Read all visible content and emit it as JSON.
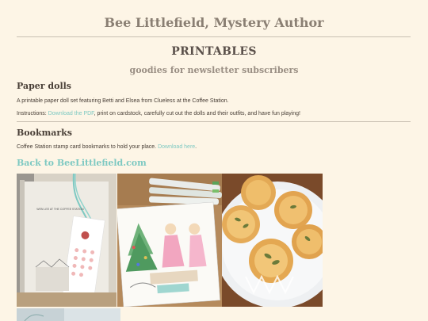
{
  "header": {
    "site_title": "Bee Littlefield, Mystery Author"
  },
  "page": {
    "title": "PRINTABLES",
    "subtitle": "goodies for newsletter subscribers"
  },
  "paper_dolls": {
    "heading": "Paper dolls",
    "description": "A printable paper doll set featuring Betti and Elsea from Clueless at the Coffee Station.",
    "instructions_prefix": "Instructions: ",
    "pdf_link": "Download the PDF",
    "instructions_suffix": ", print on cardstock, carefully cut out the dolls and their outfits, and have fun playing!"
  },
  "bookmarks": {
    "heading": "Bookmarks",
    "description_prefix": "Coffee Station stamp card bookmarks to hold your place. ",
    "download_link": "Download here",
    "description_suffix": "."
  },
  "back_link": "Back to BeeLittlefield.com",
  "photos": {
    "bookmark_book_title": "WEN LEE AT THE COFFEE STATION"
  },
  "colors": {
    "background": "#fdf5e6",
    "link": "#7ec9c2",
    "title": "#8a7f73",
    "divider": "#c9c0b3"
  }
}
